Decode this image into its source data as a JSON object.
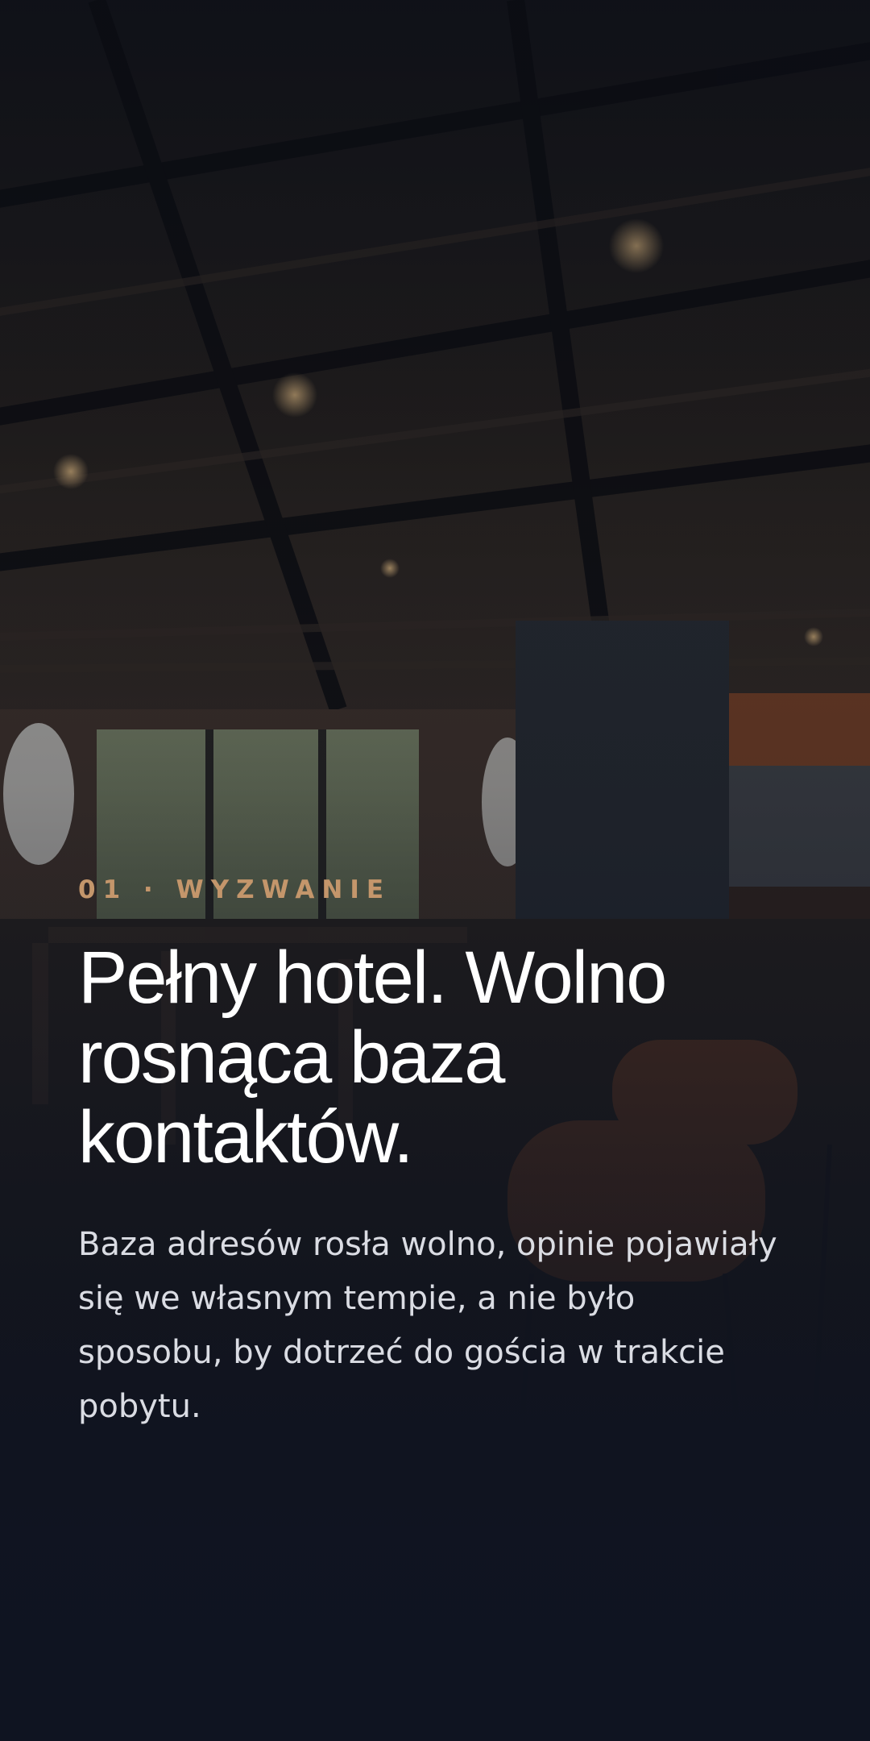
{
  "slide": {
    "eyebrow": "01 · WYZWANIE",
    "headline": "Pełny hotel. Wolno rosnąca baza kontaktów.",
    "body": "Baza adresów rosła wolno, opinie pojawiały się we własnym tempie, a nie było sposobu, by dotrzeć do gościa w trakcie pobytu."
  },
  "colors": {
    "accent": "#c4966b",
    "text": "#ffffff",
    "background": "#101521"
  }
}
